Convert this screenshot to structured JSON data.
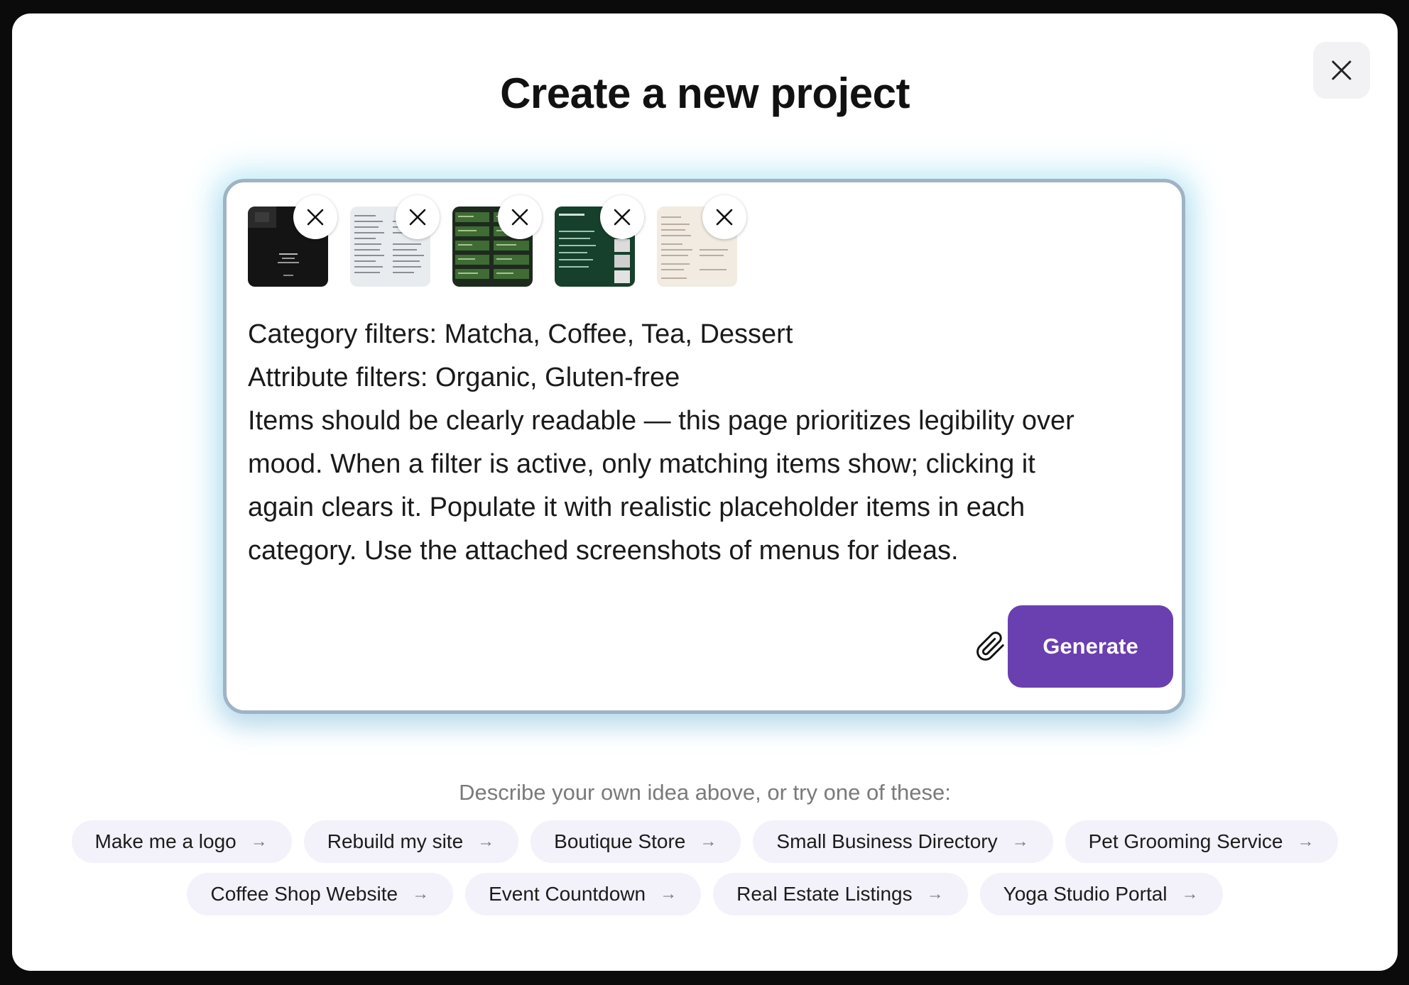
{
  "dialog": {
    "title": "Create a new project",
    "close_icon": "close-icon"
  },
  "attachments": [
    {
      "label": "attachment-1",
      "theme": "dark-menu-screenshot"
    },
    {
      "label": "attachment-2",
      "theme": "light-menu-screenshot"
    },
    {
      "label": "attachment-3",
      "theme": "dark-green-menu-screenshot"
    },
    {
      "label": "attachment-4",
      "theme": "green-menu-screenshot"
    },
    {
      "label": "attachment-5",
      "theme": "cream-menu-screenshot"
    }
  ],
  "prompt": {
    "text": "Category filters: Matcha, Coffee, Tea, Dessert\nAttribute filters: Organic, Gluten-free\nItems should be clearly readable — this page prioritizes legibility over\nmood. When a filter is active, only matching items show; clicking it\nagain clears it. Populate it with realistic placeholder items in each\ncategory. Use the attached screenshots of menus for ideas."
  },
  "actions": {
    "attach_icon": "paperclip-icon",
    "mic_icon": "microphone-icon",
    "generate_label": "Generate"
  },
  "suggestions": {
    "hint": "Describe your own idea above, or try one of these:",
    "row1": [
      "Make me a logo",
      "Rebuild my site",
      "Boutique Store",
      "Small Business Directory",
      "Pet Grooming Service"
    ],
    "row2": [
      "Coffee Shop Website",
      "Event Countdown",
      "Real Estate Listings",
      "Yoga Studio Portal"
    ],
    "arrow": "→"
  },
  "colors": {
    "accent": "#6a3fb0",
    "chip_bg": "#f3f1fa",
    "card_border": "#9fb3c4"
  }
}
